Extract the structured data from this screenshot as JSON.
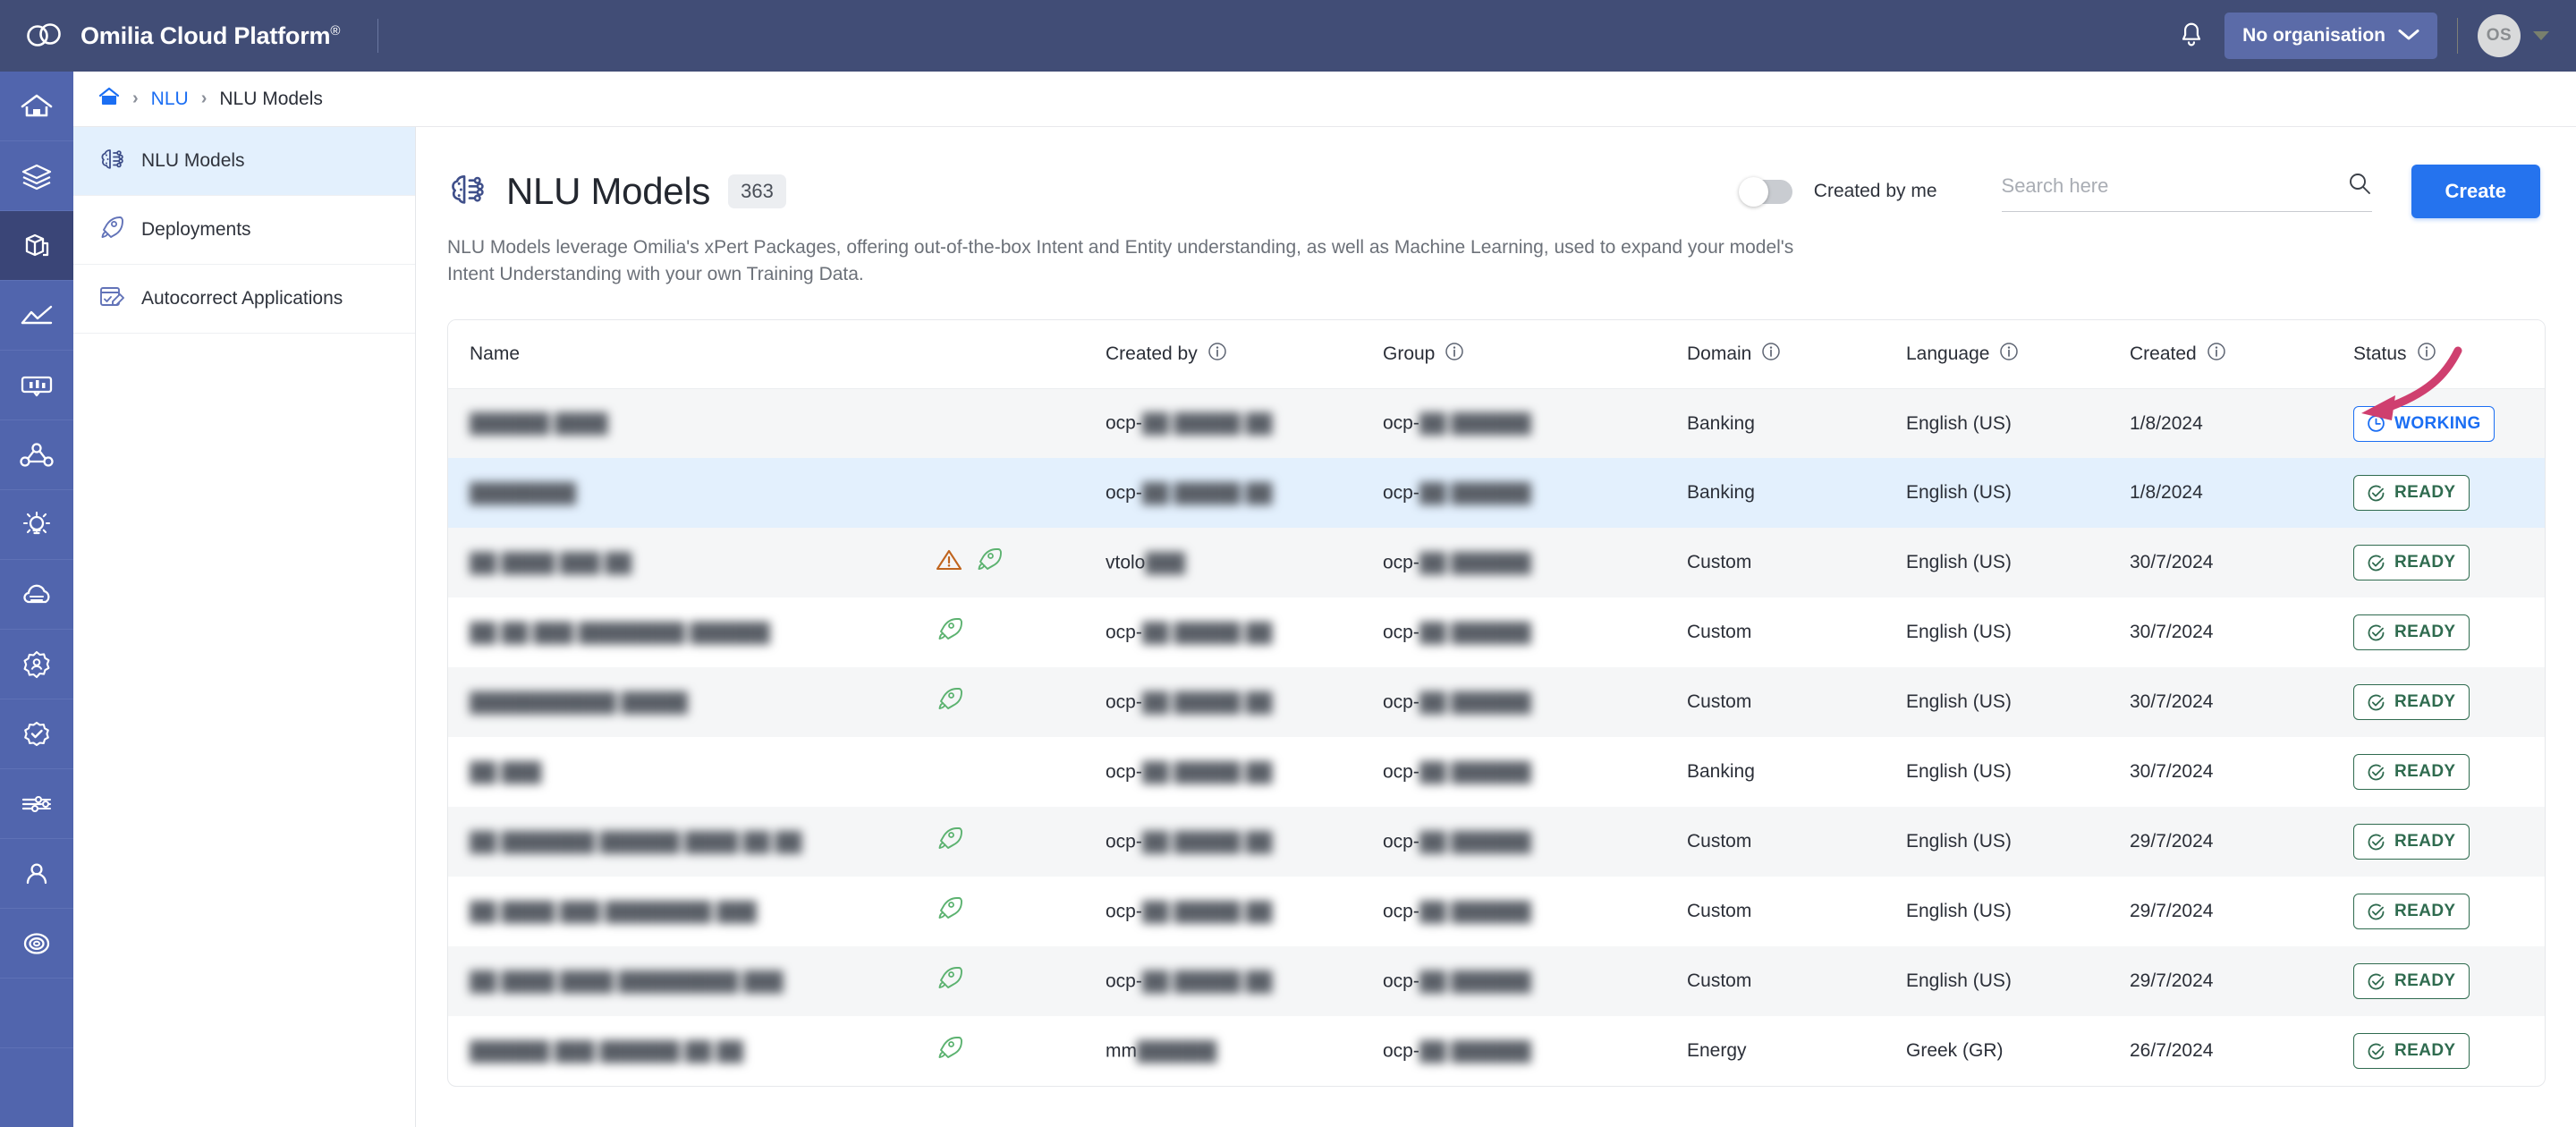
{
  "header": {
    "brand": "Omilia Cloud Platform",
    "brand_mark": "®",
    "logo_icon": "omilia-cloud-logo",
    "bell_icon": "notification-bell-icon",
    "org_label": "No organisation",
    "org_caret_icon": "chevron-down-icon",
    "avatar_initials": "OS",
    "avatar_caret_icon": "caret-down-icon"
  },
  "rail": {
    "items": [
      {
        "icon": "home-icon",
        "name": "home"
      },
      {
        "icon": "layers-icon",
        "name": "layers"
      },
      {
        "icon": "package-cube-icon",
        "name": "packages",
        "active": true
      },
      {
        "icon": "analytics-chart-icon",
        "name": "analytics"
      },
      {
        "icon": "dashboard-panel-icon",
        "name": "dashboard"
      },
      {
        "icon": "flow-nodes-icon",
        "name": "flows"
      },
      {
        "icon": "lightbulb-idea-icon",
        "name": "insights"
      },
      {
        "icon": "cloud-stack-icon",
        "name": "cloud"
      },
      {
        "icon": "gear-user-icon",
        "name": "admin"
      },
      {
        "icon": "badge-check-icon",
        "name": "compliance"
      },
      {
        "icon": "circuit-settings-icon",
        "name": "integrations"
      },
      {
        "icon": "user-icon",
        "name": "profile"
      },
      {
        "icon": "lifebuoy-help-icon",
        "name": "support"
      }
    ]
  },
  "breadcrumb": {
    "home_icon": "home-icon",
    "separator": "›",
    "link": "NLU",
    "current": "NLU Models"
  },
  "subnav": {
    "items": [
      {
        "label": "NLU Models",
        "icon": "brain-circuit-icon",
        "active": true
      },
      {
        "label": "Deployments",
        "icon": "rocket-icon",
        "active": false
      },
      {
        "label": "Autocorrect Applications",
        "icon": "edit-card-icon",
        "active": false
      }
    ]
  },
  "page": {
    "icon": "brain-circuit-icon",
    "title": "NLU Models",
    "count": "363",
    "description": "NLU Models leverage Omilia's xPert Packages, offering out-of-the-box Intent and Entity understanding, as well as Machine Learning, used to expand your model's Intent Understanding with your own Training Data."
  },
  "toolbar": {
    "toggle_label": "Created by me",
    "toggle_on": false,
    "search_placeholder": "Search here",
    "search_value": "",
    "search_icon": "search-icon",
    "create_label": "Create"
  },
  "table": {
    "columns": [
      {
        "label": "Name",
        "info": false
      },
      {
        "label": "",
        "info": false
      },
      {
        "label": "Created by",
        "info": true
      },
      {
        "label": "Group",
        "info": true
      },
      {
        "label": "Domain",
        "info": true
      },
      {
        "label": "Language",
        "info": true
      },
      {
        "label": "Created",
        "info": true
      },
      {
        "label": "Status",
        "info": true
      },
      {
        "label": "",
        "info": false
      }
    ],
    "info_icon": "info-circle-icon",
    "menu_icon": "kebab-menu-icon",
    "rows": [
      {
        "name": "██████ ████",
        "flags": [],
        "created_by_prefix": "ocp-",
        "created_by_masked": "██ █████ ██",
        "group_prefix": "ocp-",
        "group_masked": "██ ██████",
        "domain": "Banking",
        "language": "English (US)",
        "created": "1/8/2024",
        "status": "WORKING",
        "status_kind": "working",
        "selected": false,
        "stripe": "odd"
      },
      {
        "name": "████████",
        "flags": [],
        "created_by_prefix": "ocp-",
        "created_by_masked": "██ █████ ██",
        "group_prefix": "ocp-",
        "group_masked": "██ ██████",
        "domain": "Banking",
        "language": "English (US)",
        "created": "1/8/2024",
        "status": "READY",
        "status_kind": "ready",
        "selected": true,
        "stripe": "even"
      },
      {
        "name": "██ ████ ███ ██",
        "flags": [
          "warning-triangle-icon",
          "rocket-icon"
        ],
        "created_by_prefix": "vtolo",
        "created_by_masked": "███",
        "group_prefix": "ocp-",
        "group_masked": "██ ██████",
        "domain": "Custom",
        "language": "English (US)",
        "created": "30/7/2024",
        "status": "READY",
        "status_kind": "ready",
        "selected": false,
        "stripe": "odd"
      },
      {
        "name": "██ ██ ███ ████████ ██████",
        "flags": [
          "rocket-icon"
        ],
        "created_by_prefix": "ocp-",
        "created_by_masked": "██ █████ ██",
        "group_prefix": "ocp-",
        "group_masked": "██ ██████",
        "domain": "Custom",
        "language": "English (US)",
        "created": "30/7/2024",
        "status": "READY",
        "status_kind": "ready",
        "selected": false,
        "stripe": "even"
      },
      {
        "name": "███████████ █████",
        "flags": [
          "rocket-icon"
        ],
        "created_by_prefix": "ocp-",
        "created_by_masked": "██ █████ ██",
        "group_prefix": "ocp-",
        "group_masked": "██ ██████",
        "domain": "Custom",
        "language": "English (US)",
        "created": "30/7/2024",
        "status": "READY",
        "status_kind": "ready",
        "selected": false,
        "stripe": "odd"
      },
      {
        "name": "██ ███",
        "flags": [],
        "created_by_prefix": "ocp-",
        "created_by_masked": "██ █████ ██",
        "group_prefix": "ocp-",
        "group_masked": "██ ██████",
        "domain": "Banking",
        "language": "English (US)",
        "created": "30/7/2024",
        "status": "READY",
        "status_kind": "ready",
        "selected": false,
        "stripe": "even"
      },
      {
        "name": "██ ███████ ██████ ████ ██ ██",
        "flags": [
          "rocket-icon"
        ],
        "created_by_prefix": "ocp-",
        "created_by_masked": "██ █████ ██",
        "group_prefix": "ocp-",
        "group_masked": "██ ██████",
        "domain": "Custom",
        "language": "English (US)",
        "created": "29/7/2024",
        "status": "READY",
        "status_kind": "ready",
        "selected": false,
        "stripe": "odd"
      },
      {
        "name": "██ ████ ███ ████████ ███",
        "flags": [
          "rocket-icon"
        ],
        "created_by_prefix": "ocp-",
        "created_by_masked": "██ █████ ██",
        "group_prefix": "ocp-",
        "group_masked": "██ ██████",
        "domain": "Custom",
        "language": "English (US)",
        "created": "29/7/2024",
        "status": "READY",
        "status_kind": "ready",
        "selected": false,
        "stripe": "even"
      },
      {
        "name": "██ ████ ████ █████████ ███",
        "flags": [
          "rocket-icon"
        ],
        "created_by_prefix": "ocp-",
        "created_by_masked": "██ █████ ██",
        "group_prefix": "ocp-",
        "group_masked": "██ ██████",
        "domain": "Custom",
        "language": "English (US)",
        "created": "29/7/2024",
        "status": "READY",
        "status_kind": "ready",
        "selected": false,
        "stripe": "odd"
      },
      {
        "name": "██████ ███ ██████ ██ ██",
        "flags": [
          "rocket-icon"
        ],
        "created_by_prefix": "mm",
        "created_by_masked": "██████",
        "group_prefix": "ocp-",
        "group_masked": "██ ██████",
        "domain": "Energy",
        "language": "Greek (GR)",
        "created": "26/7/2024",
        "status": "READY",
        "status_kind": "ready",
        "selected": false,
        "stripe": "even"
      }
    ]
  },
  "annotation": {
    "arrow_icon": "curved-arrow-annotation",
    "arrow_color": "#cf3f6f",
    "points_to": "WORKING"
  },
  "colors": {
    "topbar": "#414d76",
    "rail": "#5165ad",
    "accent_blue": "#2573ee",
    "link_blue": "#1b6ef3",
    "ready_green": "#2f6b4f",
    "warning_orange": "#c0651f",
    "rocket_green": "#5cb270",
    "row_selected": "#e3f0fd",
    "row_stripe": "#f5f6f7"
  }
}
